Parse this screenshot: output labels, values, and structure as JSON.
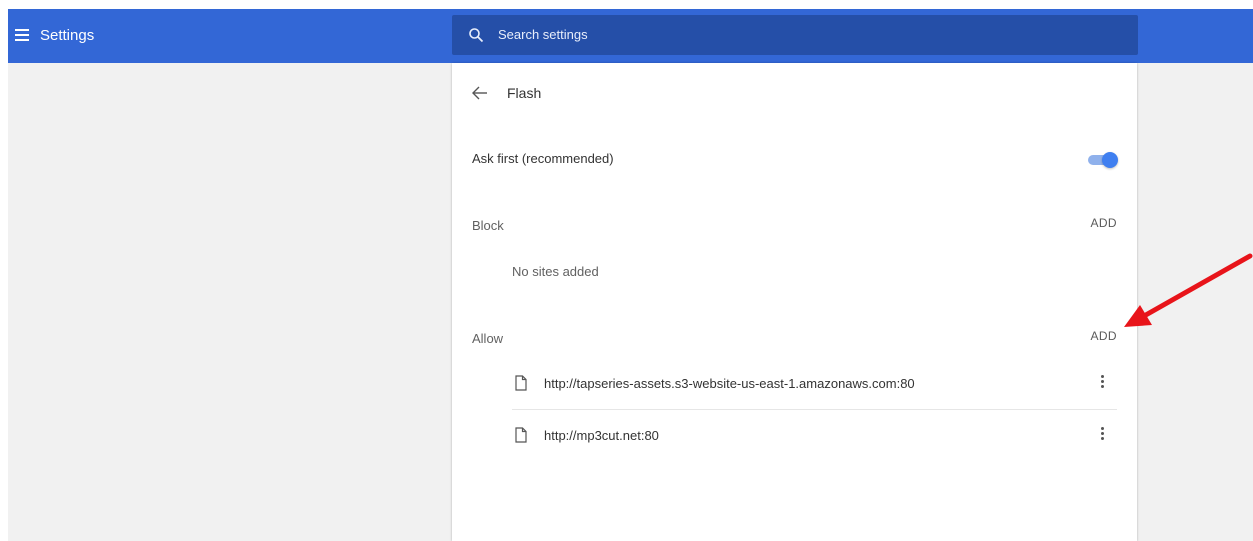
{
  "toolbar": {
    "title": "Settings",
    "search_placeholder": "Search settings",
    "menu_icon": "menu-icon",
    "search_icon": "search-icon",
    "background_color": "#3367d6"
  },
  "flash_page": {
    "title": "Flash",
    "back_icon": "arrow-left-icon",
    "ask_first": {
      "label": "Ask first (recommended)",
      "toggle_on": true,
      "toggle_color": "#3f7ff0"
    },
    "block": {
      "label": "Block",
      "add_label": "ADD",
      "empty_text": "No sites added"
    },
    "allow": {
      "label": "Allow",
      "add_label": "ADD",
      "sites": [
        {
          "url": "http://tapseries-assets.s3-website-us-east-1.amazonaws.com:80",
          "icon": "document-icon",
          "menu_icon": "more-vert-icon"
        },
        {
          "url": "http://mp3cut.net:80",
          "icon": "document-icon",
          "menu_icon": "more-vert-icon"
        }
      ]
    }
  },
  "annotation": {
    "shape": "arrow",
    "color": "#e8141a"
  }
}
